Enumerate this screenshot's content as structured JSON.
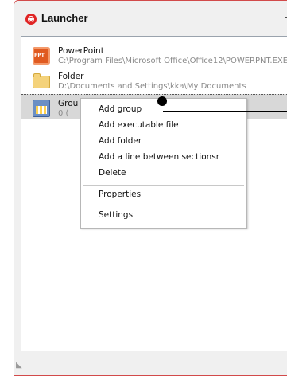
{
  "window": {
    "title": "Launcher",
    "min_label": "–",
    "max_label": "□"
  },
  "items": [
    {
      "name": "PowerPoint",
      "path": "C:\\Program Files\\Microsoft Office\\Office12\\POWERPNT.EXE",
      "icon": "powerpoint-icon"
    },
    {
      "name": "Folder",
      "path": "D:\\Documents and Settings\\kka\\My Documents",
      "icon": "folder-icon"
    },
    {
      "name": "Grou",
      "path": "0 (",
      "icon": "group-icon",
      "selected": true
    }
  ],
  "context_menu": {
    "items": [
      "Add group",
      "Add executable file",
      "Add folder",
      "Add a line between sectionsr",
      "Delete",
      "Properties",
      "Settings"
    ]
  },
  "colors": {
    "accent": "#e02424",
    "selection": "#d8d8d8"
  }
}
